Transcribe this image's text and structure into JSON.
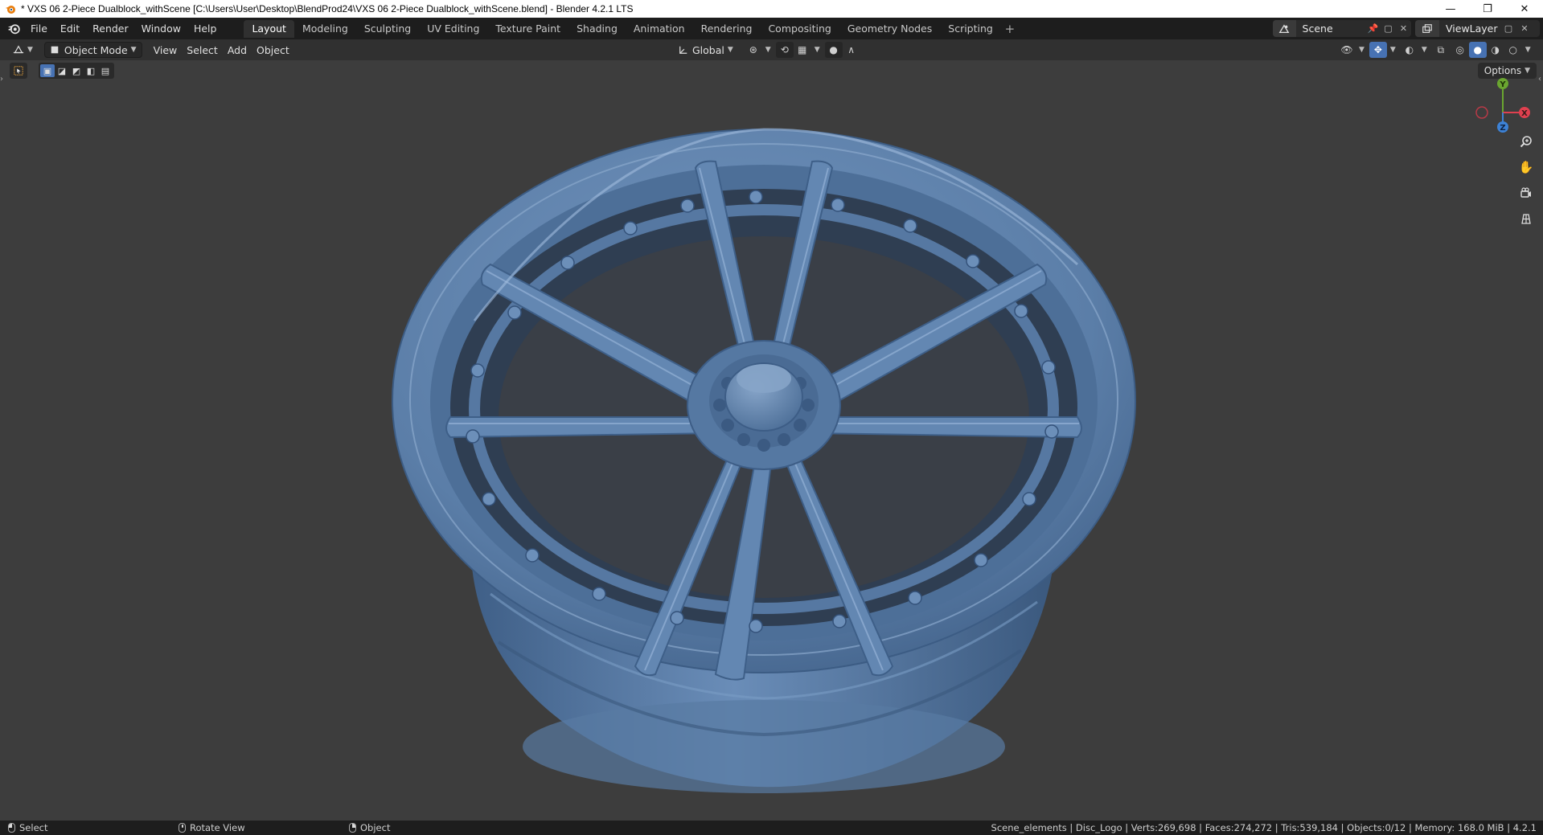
{
  "window": {
    "title": "* VXS 06 2-Piece Dualblock_withScene [C:\\Users\\User\\Desktop\\BlendProd24\\VXS 06 2-Piece Dualblock_withScene.blend] - Blender 4.2.1 LTS",
    "minimize": "—",
    "restore": "❐",
    "close": "✕"
  },
  "menu": {
    "items": [
      "File",
      "Edit",
      "Render",
      "Window",
      "Help"
    ]
  },
  "workspaces": {
    "tabs": [
      "Layout",
      "Modeling",
      "Sculpting",
      "UV Editing",
      "Texture Paint",
      "Shading",
      "Animation",
      "Rendering",
      "Compositing",
      "Geometry Nodes",
      "Scripting"
    ],
    "active": "Layout",
    "add": "+"
  },
  "scene": {
    "name": "Scene"
  },
  "view_layer": {
    "name": "ViewLayer"
  },
  "viewport_header": {
    "mode": "Object Mode",
    "menus": [
      "View",
      "Select",
      "Add",
      "Object"
    ],
    "transform_orientation": "Global"
  },
  "viewport": {
    "options_label": "Options",
    "gizmo": {
      "x_label": "X",
      "y_label": "Y",
      "z_label": "Z"
    },
    "wheel_color": "#5b81ad"
  },
  "statusbar": {
    "select": "Select",
    "rotate": "Rotate View",
    "object": "Object",
    "stats": "Scene_elements | Disc_Logo | Verts:269,698 | Faces:274,272 | Tris:539,184 | Objects:0/12 | Memory: 168.0 MiB | 4.2.1"
  },
  "colors": {
    "accent": "#4772b3",
    "axis_x": "#e0404f",
    "axis_y": "#6aa630",
    "axis_z": "#3d82d6"
  }
}
